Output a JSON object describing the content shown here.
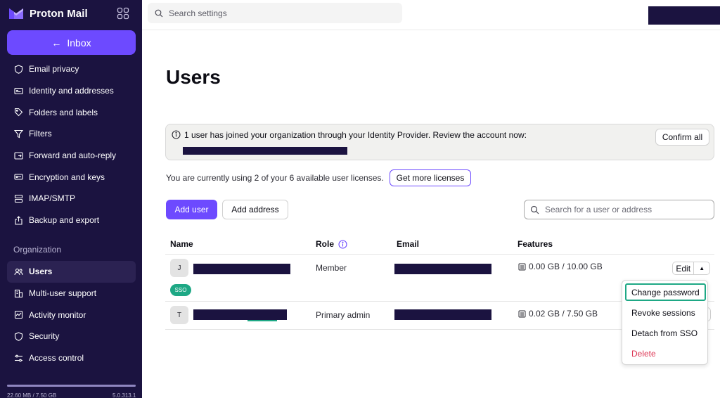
{
  "sidebar": {
    "brand": "Proton Mail",
    "inbox_label": "Inbox",
    "items": [
      {
        "label": "Email privacy",
        "icon": "shield-icon"
      },
      {
        "label": "Identity and addresses",
        "icon": "id-card-icon"
      },
      {
        "label": "Folders and labels",
        "icon": "tag-icon"
      },
      {
        "label": "Filters",
        "icon": "filter-icon"
      },
      {
        "label": "Forward and auto-reply",
        "icon": "forward-icon"
      },
      {
        "label": "Encryption and keys",
        "icon": "key-icon"
      },
      {
        "label": "IMAP/SMTP",
        "icon": "server-icon"
      },
      {
        "label": "Backup and export",
        "icon": "export-icon"
      }
    ],
    "section_title": "Organization",
    "org_items": [
      {
        "label": "Users",
        "icon": "users-icon",
        "active": true
      },
      {
        "label": "Multi-user support",
        "icon": "buildings-icon"
      },
      {
        "label": "Activity monitor",
        "icon": "activity-icon"
      },
      {
        "label": "Security",
        "icon": "shield-icon"
      },
      {
        "label": "Access control",
        "icon": "sliders-icon"
      }
    ],
    "storage_used_fraction": 1.0,
    "storage_text": "22.60 MB / 7.50 GB",
    "version": "5.0.313.1"
  },
  "topbar": {
    "search_placeholder": "Search settings"
  },
  "main": {
    "title": "Users",
    "banner": {
      "text": "1 user has joined your organization through your Identity Provider. Review the account now:",
      "confirm_label": "Confirm all"
    },
    "license_text": "You are currently using 2 of your 6 available user licenses.",
    "get_licenses_label": "Get more licenses",
    "add_user_label": "Add user",
    "add_address_label": "Add address",
    "user_search_placeholder": "Search for a user or address",
    "table": {
      "headers": {
        "name": "Name",
        "role": "Role",
        "email": "Email",
        "features": "Features"
      },
      "rows": [
        {
          "initial": "J",
          "role": "Member",
          "storage": "0.00 GB / 10.00 GB",
          "badge": "SSO",
          "action": "Edit"
        },
        {
          "initial": "T",
          "role": "Primary admin",
          "storage": "0.02 GB / 7.50 GB"
        }
      ]
    },
    "dropdown": {
      "items": [
        {
          "label": "Change password"
        },
        {
          "label": "Revoke sessions"
        },
        {
          "label": "Detach from SSO"
        },
        {
          "label": "Delete"
        }
      ]
    }
  },
  "colors": {
    "sidebar_bg": "#1b1340",
    "accent": "#6d4aff",
    "sso_badge": "#1ea885",
    "danger": "#dc3251"
  }
}
